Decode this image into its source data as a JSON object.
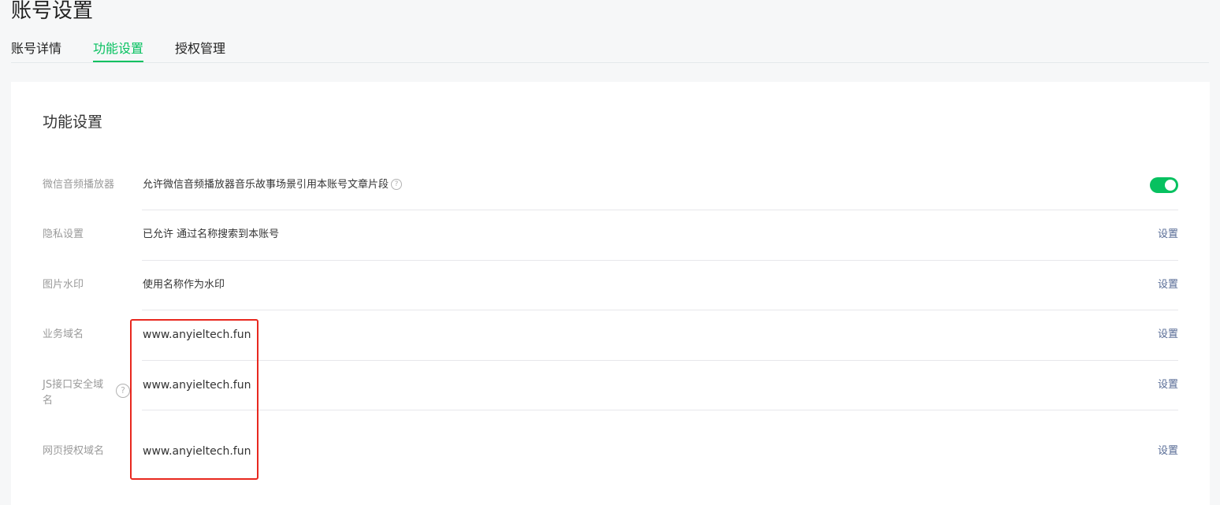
{
  "page": {
    "title": "账号设置"
  },
  "tabs": [
    {
      "label": "账号详情",
      "active": false
    },
    {
      "label": "功能设置",
      "active": true
    },
    {
      "label": "授权管理",
      "active": false
    }
  ],
  "section": {
    "title": "功能设置",
    "rows": [
      {
        "label": "微信音频播放器",
        "value": "允许微信音频播放器音乐故事场景引用本账号文章片段",
        "help_icon": "question-circle-icon",
        "control": "toggle",
        "toggle_on": true
      },
      {
        "label": "隐私设置",
        "value": "已允许 通过名称搜索到本账号",
        "action": "设置"
      },
      {
        "label": "图片水印",
        "value": "使用名称作为水印",
        "action": "设置"
      },
      {
        "label": "业务域名",
        "value": "www.anyieltech.fun",
        "action": "设置"
      },
      {
        "label": "JS接口安全域名",
        "label_line1": "JS接口安全域",
        "label_line2": "名",
        "help_icon": "question-circle-icon",
        "value": "www.anyieltech.fun",
        "action": "设置"
      },
      {
        "label": "网页授权域名",
        "value": "www.anyieltech.fun",
        "action": "设置"
      }
    ]
  },
  "colors": {
    "accent": "#07c160",
    "link": "#576b95",
    "annotation": "#e8281f"
  },
  "icons": {
    "help": "?"
  }
}
